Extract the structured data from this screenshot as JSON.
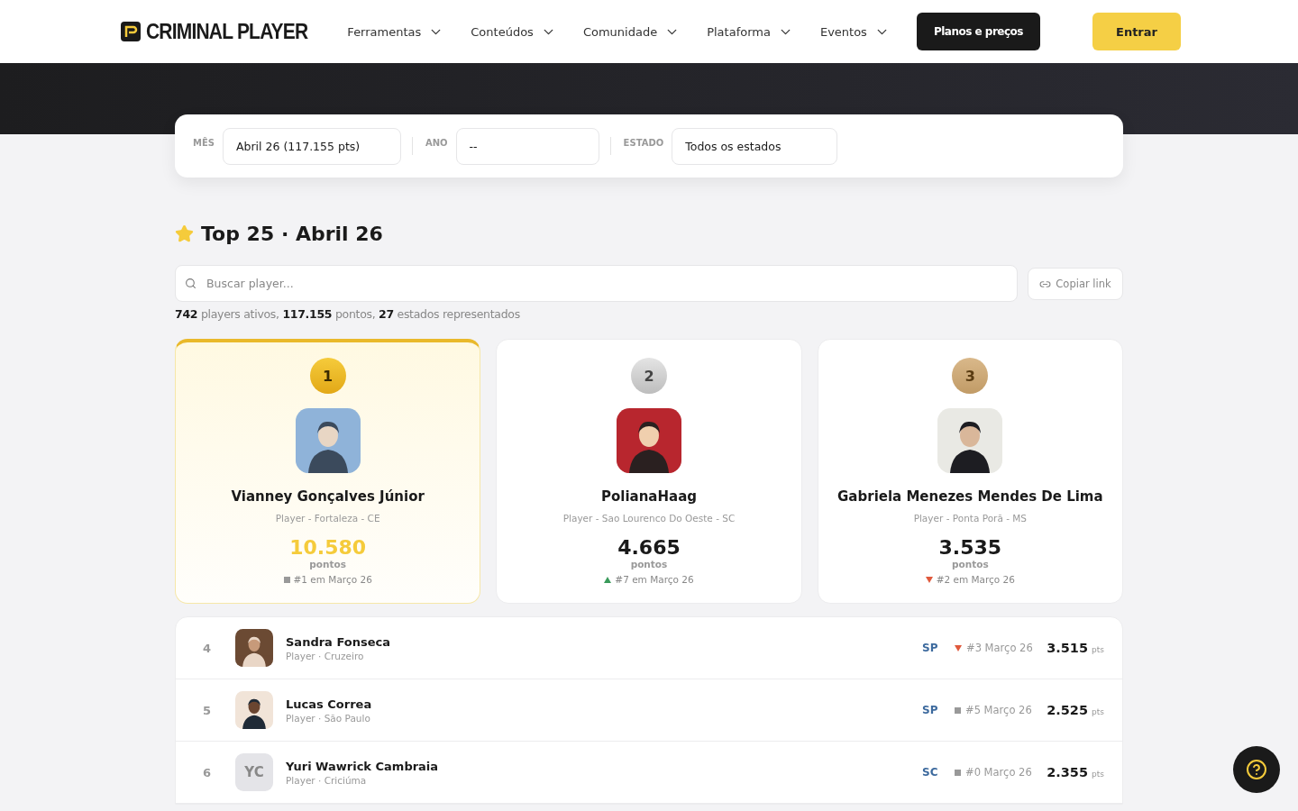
{
  "nav": {
    "logo": "CRIMINAL PLAYER",
    "menus": [
      "Ferramentas",
      "Conteúdos",
      "Comunidade",
      "Plataforma",
      "Eventos"
    ],
    "plans_button": "Planos e preços",
    "login_button": "Entrar"
  },
  "filters": [
    {
      "label": "MÊS",
      "value": "Abril 26 (117.155 pts)"
    },
    {
      "label": "ANO",
      "value": "--"
    },
    {
      "label": "ESTADO",
      "value": "Todos os estados"
    }
  ],
  "heading": "Top 25 · Abril 26",
  "search": {
    "placeholder": "Buscar player..."
  },
  "copy_button": "Copiar link",
  "stats": "**742** players ativos, **117.155** pontos, **27** estados representados",
  "podium": [
    {
      "medal": {
        "kind": "gold",
        "rank": "1"
      },
      "name": "Vianney Gonçalves Júnior",
      "subtitle": "Player - Fortaleza - CE",
      "points": "10.580",
      "points_label": "pontos",
      "previous": {
        "kind": "same",
        "text": "#1 em Março 26"
      }
    },
    {
      "medal": {
        "kind": "silver",
        "rank": "2"
      },
      "name": "PolianaHaag",
      "subtitle": "Player - Sao Lourenco Do Oeste - SC",
      "points": "4.665",
      "points_label": "pontos",
      "previous": {
        "kind": "up",
        "text": "#7 em Março 26"
      }
    },
    {
      "medal": {
        "kind": "bronze",
        "rank": "3"
      },
      "name": "Gabriela Menezes Mendes De Lima",
      "subtitle": "Player - Ponta Porã - MS",
      "points": "3.535",
      "points_label": "pontos",
      "previous": {
        "kind": "down",
        "text": "#2 em Março 26"
      }
    }
  ],
  "rows": [
    {
      "rank": "4",
      "name": "Sandra Fonseca",
      "subtitle": "Player · Cruzeiro",
      "state": "SP",
      "previous": {
        "kind": "down",
        "text": "#3 Março 26"
      },
      "points": "3.515",
      "unit": "pts"
    },
    {
      "rank": "5",
      "name": "Lucas Correa",
      "subtitle": "Player · São Paulo",
      "state": "SP",
      "previous": {
        "kind": "same",
        "text": "#5 Março 26"
      },
      "points": "2.525",
      "unit": "pts"
    },
    {
      "rank": "6",
      "avatar": {
        "kind": "initials",
        "text": "YC"
      },
      "name": "Yuri Wawrick Cambraia",
      "subtitle": "Player · Criciúma",
      "state": "SC",
      "previous": {
        "kind": "same",
        "text": "#0 Março 26"
      },
      "points": "2.355",
      "unit": "pts"
    }
  ]
}
